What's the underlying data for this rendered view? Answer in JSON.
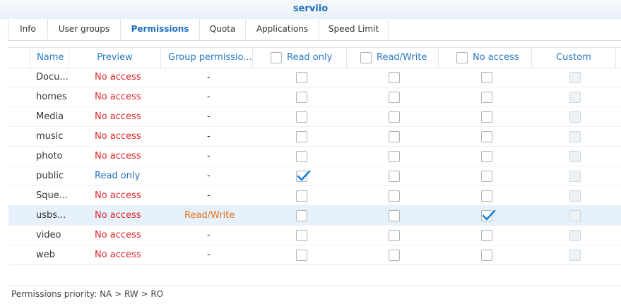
{
  "window": {
    "title": "serviio"
  },
  "tabs": [
    {
      "label": "Info",
      "active": false
    },
    {
      "label": "User groups",
      "active": false
    },
    {
      "label": "Permissions",
      "active": true
    },
    {
      "label": "Quota",
      "active": false
    },
    {
      "label": "Applications",
      "active": false
    },
    {
      "label": "Speed Limit",
      "active": false
    }
  ],
  "table": {
    "headers": {
      "name": "Name",
      "preview": "Preview",
      "group_permissions": "Group permissio...",
      "read_only": "Read only",
      "read_write": "Read/Write",
      "no_access": "No access",
      "custom": "Custom"
    },
    "rows": [
      {
        "name": "Docu...",
        "preview": "No access",
        "group": "-",
        "ro": false,
        "rw": false,
        "na": false,
        "selected": false
      },
      {
        "name": "homes",
        "preview": "No access",
        "group": "-",
        "ro": false,
        "rw": false,
        "na": false,
        "selected": false
      },
      {
        "name": "Media",
        "preview": "No access",
        "group": "-",
        "ro": false,
        "rw": false,
        "na": false,
        "selected": false
      },
      {
        "name": "music",
        "preview": "No access",
        "group": "-",
        "ro": false,
        "rw": false,
        "na": false,
        "selected": false
      },
      {
        "name": "photo",
        "preview": "No access",
        "group": "-",
        "ro": false,
        "rw": false,
        "na": false,
        "selected": false
      },
      {
        "name": "public",
        "preview": "Read only",
        "group": "-",
        "ro": true,
        "rw": false,
        "na": false,
        "selected": false
      },
      {
        "name": "Sque...",
        "preview": "No access",
        "group": "-",
        "ro": false,
        "rw": false,
        "na": false,
        "selected": false
      },
      {
        "name": "usbs...",
        "preview": "No access",
        "group": "Read/Write",
        "ro": false,
        "rw": false,
        "na": true,
        "selected": true
      },
      {
        "name": "video",
        "preview": "No access",
        "group": "-",
        "ro": false,
        "rw": false,
        "na": false,
        "selected": false
      },
      {
        "name": "web",
        "preview": "No access",
        "group": "-",
        "ro": false,
        "rw": false,
        "na": false,
        "selected": false
      }
    ]
  },
  "footer": {
    "text": "Permissions priority: NA > RW > RO"
  },
  "colors": {
    "accent": "#1f6fbf",
    "no_access": "#e0252a",
    "read_write": "#e8731c",
    "selected_row": "#e6f1fb"
  }
}
